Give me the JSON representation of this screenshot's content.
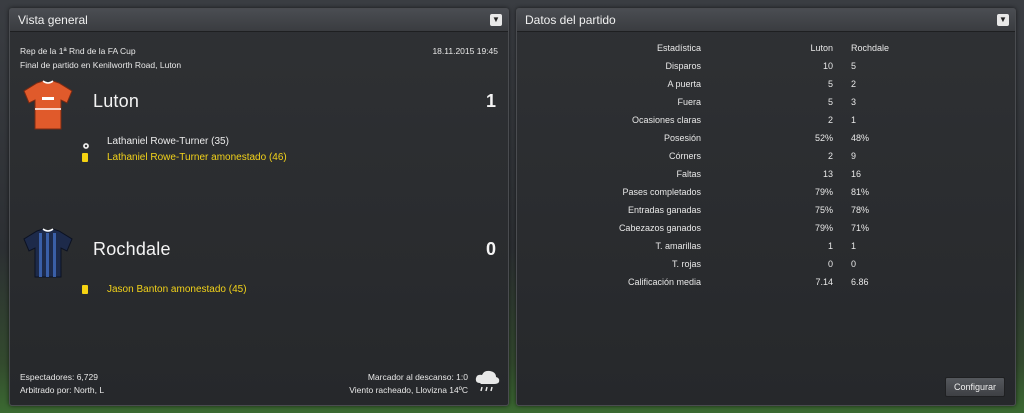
{
  "overview": {
    "title": "Vista general",
    "competition": "Rep de la 1ª Rnd de la FA Cup",
    "datetime": "18.11.2015 19:45",
    "result_line": "Final de partido en Kenilworth Road, Luton",
    "home": {
      "name": "Luton",
      "score": "1",
      "shirt_color": "#e05a2b",
      "events": [
        {
          "type": "goal",
          "icon": "ball-icon",
          "text": "Lathaniel Rowe-Turner (35)"
        },
        {
          "type": "yellow-card",
          "icon": "yellow-card-icon",
          "text": "Lathaniel Rowe-Turner amonestado (46)"
        }
      ]
    },
    "away": {
      "name": "Rochdale",
      "score": "0",
      "shirt_color": "#1d2a4a",
      "events": [
        {
          "type": "yellow-card",
          "icon": "yellow-card-icon",
          "text": "Jason Banton amonestado (45)"
        }
      ]
    },
    "footer": {
      "attendance": "Espectadores: 6,729",
      "referee": "Arbitrado por: North, L",
      "halftime": "Marcador al descanso: 1:0",
      "weather": "Viento racheado, Llovizna 14ºC",
      "weather_icon": "rain-cloud-icon"
    }
  },
  "stats": {
    "title": "Datos del partido",
    "header": {
      "label": "Estadística",
      "home": "Luton",
      "away": "Rochdale"
    },
    "rows": [
      {
        "label": "Disparos",
        "home": "10",
        "away": "5"
      },
      {
        "label": "A puerta",
        "home": "5",
        "away": "2"
      },
      {
        "label": "Fuera",
        "home": "5",
        "away": "3"
      },
      {
        "label": "Ocasiones claras",
        "home": "2",
        "away": "1"
      },
      {
        "label": "Posesión",
        "home": "52%",
        "away": "48%"
      },
      {
        "label": "Córners",
        "home": "2",
        "away": "9"
      },
      {
        "label": "Faltas",
        "home": "13",
        "away": "16"
      },
      {
        "label": "Pases completados",
        "home": "79%",
        "away": "81%"
      },
      {
        "label": "Entradas ganadas",
        "home": "75%",
        "away": "78%"
      },
      {
        "label": "Cabezazos ganados",
        "home": "79%",
        "away": "71%"
      },
      {
        "label": "T. amarillas",
        "home": "1",
        "away": "1"
      },
      {
        "label": "T. rojas",
        "home": "0",
        "away": "0"
      },
      {
        "label": "Calificación media",
        "home": "7.14",
        "away": "6.86"
      }
    ],
    "configure_label": "Configurar"
  },
  "colors": {
    "accent_yellow": "#f2d21a",
    "panel_bg": "#2a2c2f"
  }
}
